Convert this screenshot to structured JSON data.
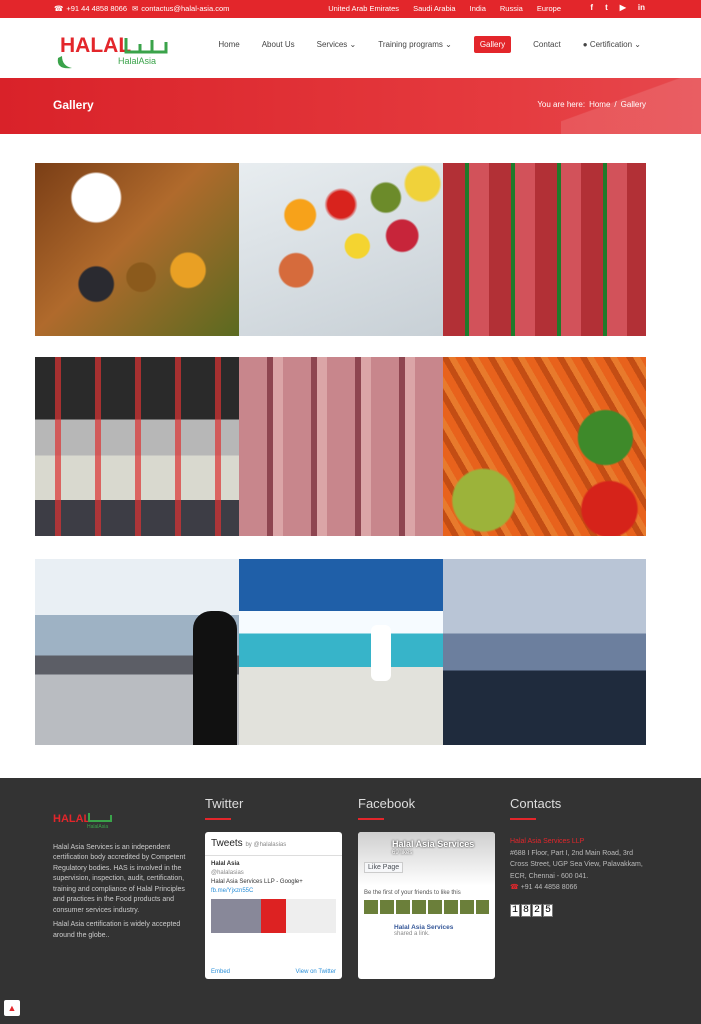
{
  "topbar": {
    "phone": "+91 44 4858 8066",
    "email": "contactus@halal-asia.com",
    "countries": [
      "United Arab Emirates",
      "Saudi Arabia",
      "India",
      "Russia",
      "Europe"
    ],
    "social": [
      "facebook-icon",
      "twitter-icon",
      "youtube-icon",
      "linkedin-icon"
    ]
  },
  "header": {
    "logo_text": "HALAL",
    "logo_sub": "HalalAsia"
  },
  "nav": [
    "Home",
    "About Us",
    "Services",
    "Training programs",
    "Gallery",
    "Contact",
    "Certification"
  ],
  "banner": {
    "title": "Gallery",
    "you_are_here": "You are here:",
    "home": "Home",
    "current": "Gallery"
  },
  "footer": {
    "about": "Halal Asia Services is an independent certification body accredited by Competent Regulatory bodies. HAS is involved in the supervision, inspection, audit, certification, training and compliance of Halal Principles and practices in the Food products and consumer services industry.",
    "about2": "Halal Asia certification is widely accepted around the globe..",
    "twitter_title": "Twitter",
    "facebook_title": "Facebook",
    "contacts_title": "Contacts",
    "tweets": {
      "title": "Tweets",
      "by": "by @halalasias",
      "name": "Halal Asia",
      "handle": "@halalasias",
      "text": "Halal Asia Services LLP - Google+",
      "link": "fb.me/Yjxzn55C",
      "embed": "Embed",
      "view": "View on Twitter"
    },
    "fb": {
      "page": "Halal Asia Services",
      "likes": "69 likes",
      "like_btn": "Like Page",
      "first": "Be the first of your friends to like this",
      "post_name": "Halal Asia Services",
      "post_text": "shared a link."
    },
    "company": "Halal Asia Services LLP",
    "address": "#688 I Floor, Part I, 2nd Main Road, 3rd Cross Street, UGP Sea View, Palavakkam, ECR, Chennai - 600 041.",
    "phone": "+91 44 4858 8066",
    "counter": [
      "1",
      "8",
      "2",
      "5"
    ]
  }
}
